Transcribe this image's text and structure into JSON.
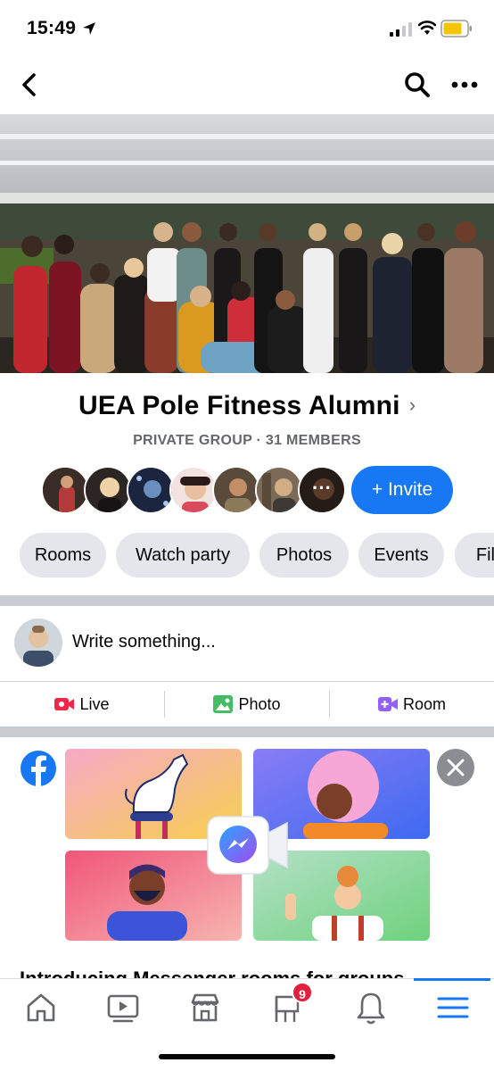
{
  "status_bar": {
    "time": "15:49"
  },
  "group": {
    "name": "UEA Pole Fitness Alumni",
    "meta": "PRIVATE GROUP · 31 MEMBERS",
    "more_members": "···",
    "invite_label": "+ Invite"
  },
  "chips": [
    "Rooms",
    "Watch party",
    "Photos",
    "Events",
    "Files"
  ],
  "composer": {
    "prompt": "Write something...",
    "actions": [
      {
        "label": "Live",
        "icon": "live-video-icon",
        "color": "#f02849"
      },
      {
        "label": "Photo",
        "icon": "photo-icon",
        "color": "#45bd62"
      },
      {
        "label": "Room",
        "icon": "room-video-icon",
        "color": "#9360f7"
      }
    ]
  },
  "promo": {
    "title": "Introducing Messenger rooms for groups"
  },
  "tab_bar": {
    "items": [
      "home-icon",
      "watch-icon",
      "marketplace-icon",
      "groups-icon",
      "notifications-icon",
      "menu-icon"
    ],
    "groups_badge": "9",
    "active": "menu-icon"
  },
  "colors": {
    "accent": "#1877f2",
    "chip_bg": "#e4e6eb",
    "divider": "#c9ccd1"
  }
}
